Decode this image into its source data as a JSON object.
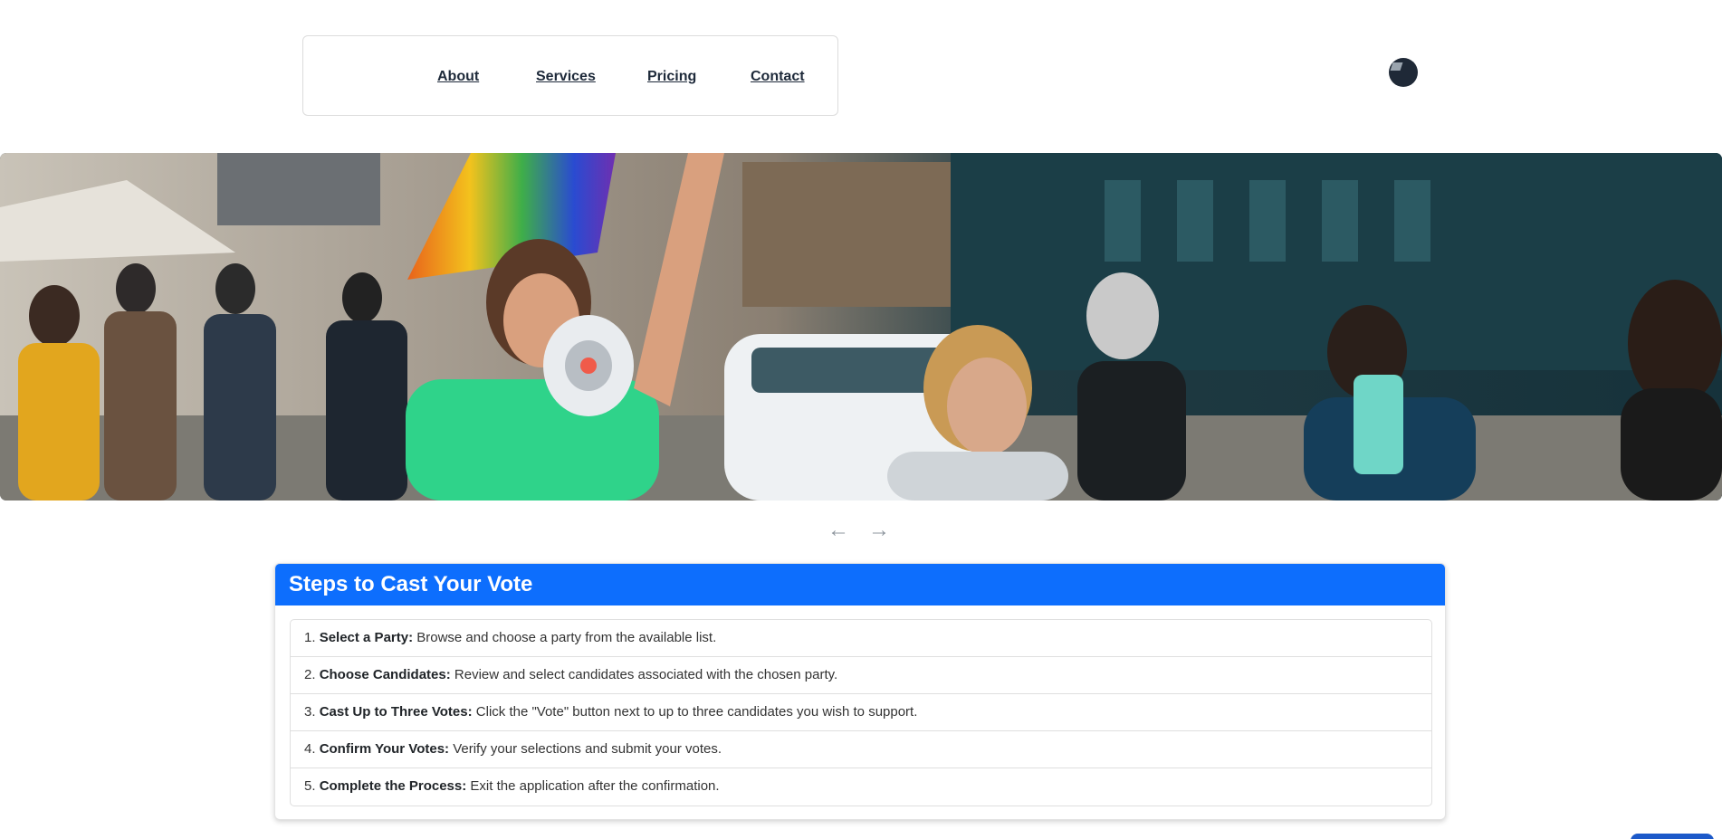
{
  "nav": {
    "items": [
      "About",
      "Services",
      "Pricing",
      "Contact"
    ]
  },
  "carousel": {
    "prev_icon": "arrow-left-icon",
    "next_icon": "arrow-right-icon",
    "prev_glyph": "←",
    "next_glyph": "→"
  },
  "steps_card": {
    "title": "Steps to Cast Your Vote",
    "steps": [
      {
        "num": "1.",
        "label": "Select a Party:",
        "text": "Browse and choose a party from the available list."
      },
      {
        "num": "2.",
        "label": "Choose Candidates:",
        "text": "Review and select candidates associated with the chosen party."
      },
      {
        "num": "3.",
        "label": "Cast Up to Three Votes:",
        "text": "Click the \"Vote\" button next to up to three candidates you wish to support."
      },
      {
        "num": "4.",
        "label": "Confirm Your Votes:",
        "text": "Verify your selections and submit your votes."
      },
      {
        "num": "5.",
        "label": "Complete the Process:",
        "text": "Exit the application after the confirmation."
      }
    ]
  },
  "colors": {
    "primary": "#0d6efd",
    "nav_text": "#1e2a3a",
    "arrow": "#8e969e"
  }
}
